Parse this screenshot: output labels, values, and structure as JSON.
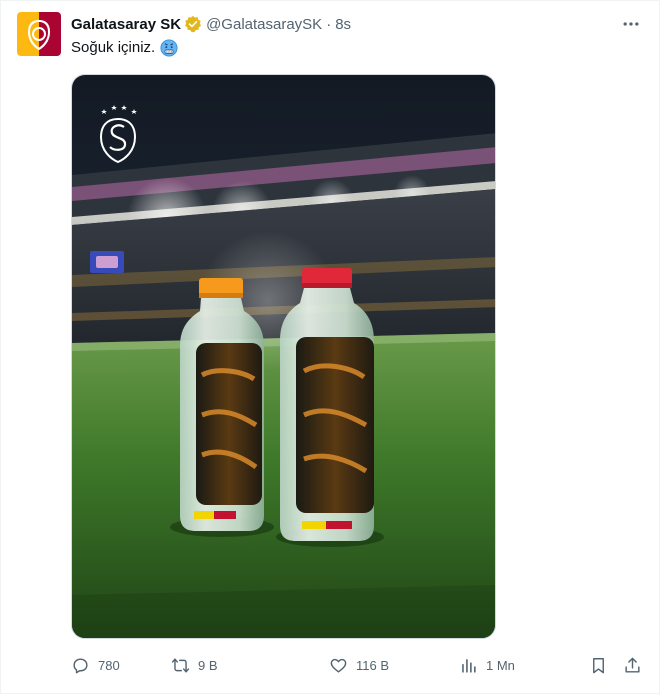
{
  "tweet": {
    "display_name": "Galatasaray SK",
    "handle": "@GalatasaraySK",
    "separator": "·",
    "time": "8s",
    "text": "Soğuk içiniz.",
    "emoji": "cold-face-emoji",
    "verified": "gold-verified-badge"
  },
  "actions": {
    "replies": "780",
    "reposts": "9 B",
    "likes": "116 B",
    "views": "1 Mn"
  },
  "colors": {
    "brand_red": "#a90432",
    "brand_yellow": "#fdb912",
    "muted_text": "#536471",
    "pitch_green": "#3f7a2a"
  },
  "icons": [
    "more-icon",
    "reply-icon",
    "retweet-icon",
    "like-icon",
    "views-icon",
    "bookmark-icon",
    "share-icon"
  ]
}
